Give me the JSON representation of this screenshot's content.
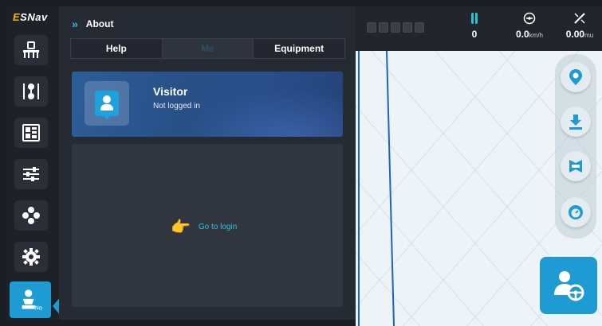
{
  "app": {
    "logo_prefix": "E",
    "logo_rest": "SNav"
  },
  "sidebar": {
    "items": [
      {
        "name": "implement-icon"
      },
      {
        "name": "guidance-ab-icon"
      },
      {
        "name": "field-grid-icon"
      },
      {
        "name": "settings-sliders-icon"
      },
      {
        "name": "modules-icon"
      },
      {
        "name": "gear-icon"
      },
      {
        "name": "operator-icon",
        "badge": "No"
      }
    ]
  },
  "panel": {
    "title": "About",
    "tabs": [
      {
        "label": "Help",
        "active": false
      },
      {
        "label": "Me",
        "active": true
      },
      {
        "label": "Equipment",
        "active": false
      }
    ],
    "profile": {
      "name": "Visitor",
      "status": "Not logged in"
    },
    "login_link": "Go to login"
  },
  "status_bar": {
    "satellites": "0",
    "speed_value": "0.0",
    "speed_unit": "km/h",
    "area_value": "0.00",
    "area_unit": "mu"
  },
  "right_tools": [
    {
      "name": "location-pin-icon"
    },
    {
      "name": "download-icon"
    },
    {
      "name": "boundary-icon"
    },
    {
      "name": "gauge-icon"
    }
  ],
  "colors": {
    "accent": "#1f9bd4",
    "link": "#2fc4d8",
    "logo_accent": "#ffb400",
    "profile_card": "#2c5d9a"
  }
}
